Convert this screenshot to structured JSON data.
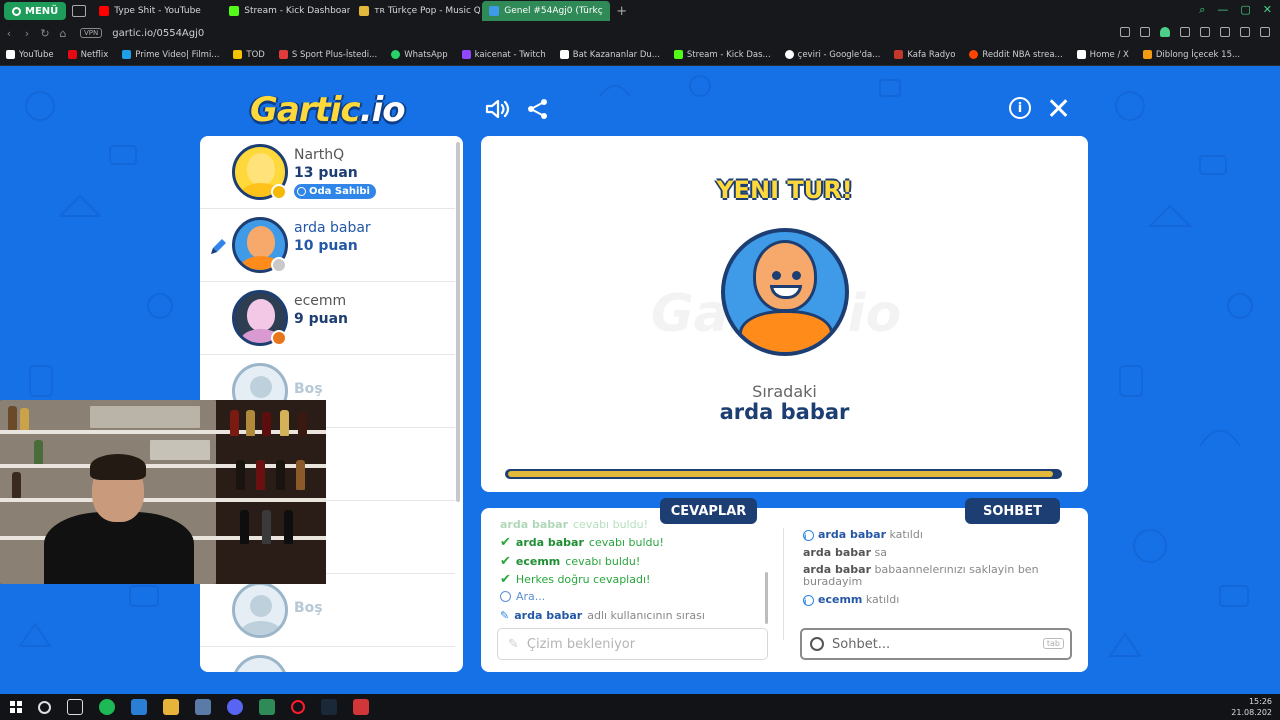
{
  "browser": {
    "menu_label": "MENÜ",
    "tabs": [
      {
        "label": "Type Shit - YouTube",
        "favicon_color": "#ff0000"
      },
      {
        "label": "Stream - Kick Dashboard",
        "favicon_color": "#53fc18"
      },
      {
        "label": "ᴛʀ Türkçe Pop - Music Q",
        "favicon_color": "#e2b93a"
      },
      {
        "label": "Genel #54Agj0 (Türkç",
        "favicon_color": "#3f9be8"
      }
    ],
    "new_tab": "+",
    "vpn": "VPN",
    "url": "gartic.io/0554Agj0",
    "bookmarks": [
      {
        "label": "YouTube",
        "color": "#ffffff"
      },
      {
        "label": "Netflix",
        "color": "#e50914"
      },
      {
        "label": "Prime Video| Filmi...",
        "color": "#1ea0e8"
      },
      {
        "label": "TOD",
        "color": "#f5c400"
      },
      {
        "label": "S Sport Plus-İstedi...",
        "color": "#e23b3b"
      },
      {
        "label": "WhatsApp",
        "color": "#25d366"
      },
      {
        "label": "kaicenat - Twitch",
        "color": "#9146ff"
      },
      {
        "label": "Bat Kazananlar Du...",
        "color": "#ffffff"
      },
      {
        "label": "Stream - Kick Das...",
        "color": "#53fc18"
      },
      {
        "label": "çeviri - Google'da...",
        "color": "#ffffff"
      },
      {
        "label": "Kafa Radyo",
        "color": "#c0392b"
      },
      {
        "label": "Reddit NBA strea...",
        "color": "#ff4500"
      },
      {
        "label": "Home / X",
        "color": "#ffffff"
      },
      {
        "label": "Diblong İçecek 15...",
        "color": "#f39c12"
      }
    ]
  },
  "game": {
    "logo_main": "Gartic",
    "logo_suffix": ".io",
    "sound_icon": "volume-icon",
    "share_icon": "share-icon",
    "info_icon": "i",
    "close_icon": "✕",
    "players": [
      {
        "name": "NarthQ",
        "points": "13 puan",
        "badge": "Oda Sahibi",
        "avatar_style": "yellow",
        "status_color": "#f5b800",
        "drawer": false
      },
      {
        "name": "arda babar",
        "points": "10 puan",
        "badge": "",
        "avatar_style": "blue",
        "status_color": "#c9c9c9",
        "drawer": true
      },
      {
        "name": "ecemm",
        "points": "9 puan",
        "badge": "",
        "avatar_style": "dark",
        "status_color": "#e8751a",
        "drawer": false
      },
      {
        "name": "Boş",
        "points": "",
        "badge": "",
        "avatar_style": "empty",
        "status_color": "",
        "drawer": false
      },
      {
        "name": "Boş",
        "points": "",
        "badge": "",
        "avatar_style": "empty",
        "status_color": "",
        "drawer": false
      }
    ],
    "canvas": {
      "watermark": "Gartic.io",
      "round_title": "YENI TUR!",
      "next_label": "Sıradaki",
      "next_name": "arda babar",
      "progress": 0.99
    },
    "answers": {
      "tab_label": "CEVAPLAR",
      "messages": [
        {
          "who": "arda babar",
          "text": "cevabı buldu!",
          "type": "green",
          "faded": true
        },
        {
          "who": "arda babar",
          "text": "cevabı buldu!",
          "type": "green",
          "faded": false
        },
        {
          "who": "ecemm",
          "text": "cevabı buldu!",
          "type": "green",
          "faded": false
        },
        {
          "who": "",
          "text": "Herkes doğru cevapladı!",
          "type": "green",
          "faded": false
        },
        {
          "who": "",
          "text": "Ara...",
          "type": "blue",
          "faded": false
        },
        {
          "who": "arda babar",
          "text": "adlı kullanıcının sırası",
          "type": "draw",
          "faded": false
        }
      ],
      "placeholder": "Çizim bekleniyor"
    },
    "chat": {
      "tab_label": "SOHBET",
      "messages": [
        {
          "who": "arda babar",
          "text": "katıldı",
          "join": true
        },
        {
          "who": "arda babar",
          "text": "sa",
          "join": false
        },
        {
          "who": "arda babar",
          "text": "babaannelerınızı saklayin ben buradayim",
          "join": false
        },
        {
          "who": "ecemm",
          "text": "katıldı",
          "join": true
        }
      ],
      "placeholder": "Sohbet...",
      "tab_hint": "tab"
    }
  },
  "taskbar": {
    "time": "15:26",
    "date": "21.08.202"
  }
}
